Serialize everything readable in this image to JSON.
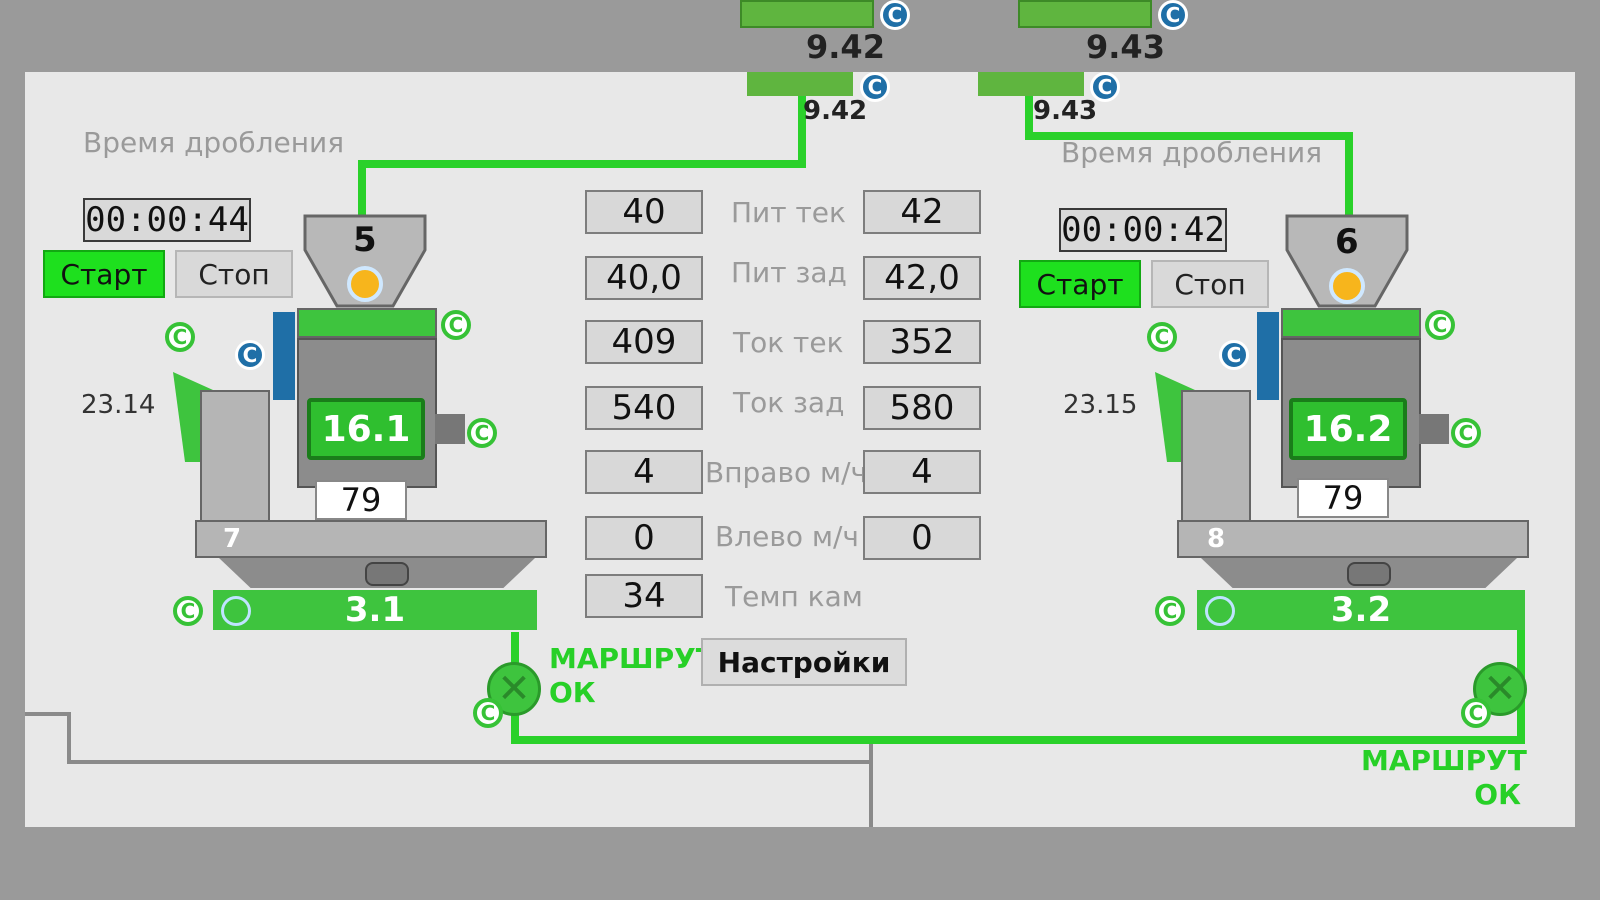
{
  "background": {
    "top_left_value": "9.42",
    "top_right_value": "9.43"
  },
  "center": {
    "labels": [
      "Пит тек",
      "Пит зад",
      "Ток тек",
      "Ток зад",
      "Вправо м/ч",
      "Влево м/ч",
      "Темп кам"
    ],
    "left_values": [
      "40",
      "40,0",
      "409",
      "540",
      "4",
      "0",
      "34"
    ],
    "right_values": [
      "42",
      "42,0",
      "352",
      "580",
      "4",
      "0"
    ],
    "settings_label": "Настройки"
  },
  "left_unit": {
    "feed_value": "9.42",
    "timer_label": "Время дробления",
    "timer": "00:00:44",
    "start_label": "Старт",
    "stop_label": "Стоп",
    "hopper_number": "5",
    "side_value": "23.14",
    "crusher_id": "16.1",
    "percent": "79",
    "base_number": "7",
    "conveyor": "3.1",
    "route_line1": "МАРШРУТ",
    "route_line2": "ОК"
  },
  "right_unit": {
    "feed_value": "9.43",
    "timer_label": "Время дробления",
    "timer": "00:00:42",
    "start_label": "Старт",
    "stop_label": "Стоп",
    "hopper_number": "6",
    "side_value": "23.15",
    "crusher_id": "16.2",
    "percent": "79",
    "base_number": "8",
    "conveyor": "3.2",
    "route_line1": "МАРШРУТ",
    "route_line2": "ОК"
  },
  "badge_letter": "C",
  "colors": {
    "pipe": "#2ad12a",
    "running": "#1ee01e",
    "panel": "#e8e8e8",
    "badge_blue": "#1f6fa7"
  }
}
